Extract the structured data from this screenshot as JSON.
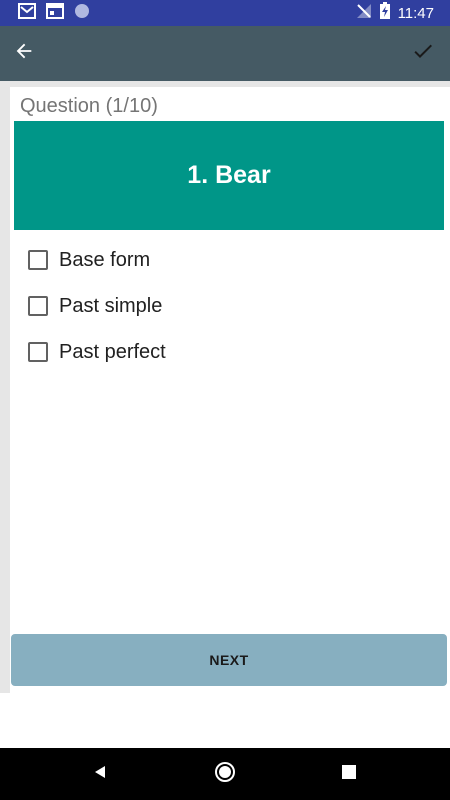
{
  "status_bar": {
    "time": "11:47",
    "left_icons": [
      "gmail-icon",
      "calendar-icon",
      "circle-icon"
    ],
    "right_icons": [
      "signal-off-icon",
      "battery-charging-icon"
    ]
  },
  "toolbar": {
    "back_icon": "arrow-back-icon",
    "confirm_icon": "checkmark-icon"
  },
  "quiz": {
    "counter": "Question (1/10)",
    "question": "1. Bear",
    "options": [
      {
        "label": "Base form",
        "checked": false
      },
      {
        "label": "Past simple",
        "checked": false
      },
      {
        "label": "Past perfect",
        "checked": false
      }
    ],
    "next_label": "NEXT"
  },
  "nav_bar": {
    "icons": [
      "back-triangle-icon",
      "home-circle-icon",
      "recents-square-icon"
    ]
  },
  "colors": {
    "status_bar": "#303f9f",
    "toolbar": "#455a64",
    "banner": "#009688",
    "next_button": "#87afc0",
    "background": "#e6e6e6"
  }
}
